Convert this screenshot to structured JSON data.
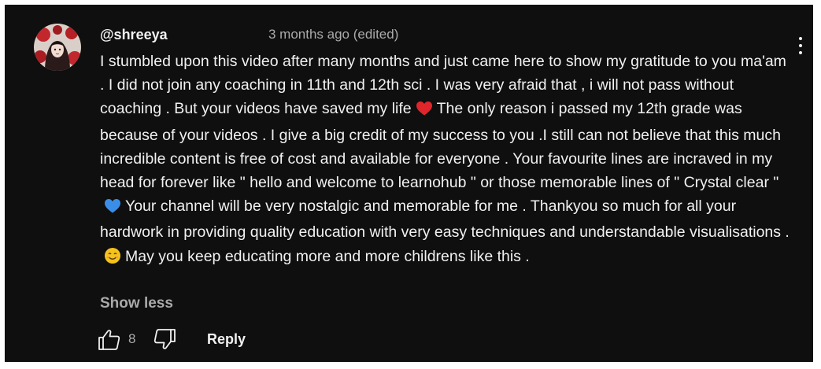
{
  "comment": {
    "author": "@shreeya",
    "timestamp": "3 months ago (edited)",
    "avatar_icon": "profile-avatar",
    "text_segments": [
      "I stumbled upon this video after many months and just came here to show my gratitude to you ma'am . I did not join any coaching in 11th and 12th sci . I was very afraid that , i will not pass without coaching . But your videos have saved my life",
      "The only reason i passed my 12th grade was because of your videos . I give a big credit of my success to you .I still can not believe that this much incredible content is free of cost and available for everyone . Your favourite lines are incraved in my head for forever like \" hello and welcome to learnohub \" or those memorable lines of \" Crystal clear \"",
      "Your channel will be very nostalgic and memorable for me . Thankyou so much for all your hardwork in providing quality education with very easy techniques and understandable visualisations .",
      "May you keep educating more and more childrens like this ."
    ],
    "emojis": [
      "red-heart",
      "blue-heart",
      "smiling-face"
    ],
    "show_less_label": "Show less",
    "like_count": "8",
    "reply_label": "Reply"
  },
  "colors": {
    "background": "#0f0f0f",
    "text_primary": "#f1f1f1",
    "text_secondary": "#aaaaaa",
    "red_heart": "#e0252b",
    "blue_heart": "#3b8ee8",
    "smile_emoji": "#f4c21b"
  },
  "icons": {
    "more": "vertical-ellipsis-icon",
    "like": "thumbs-up-icon",
    "dislike": "thumbs-down-icon"
  }
}
